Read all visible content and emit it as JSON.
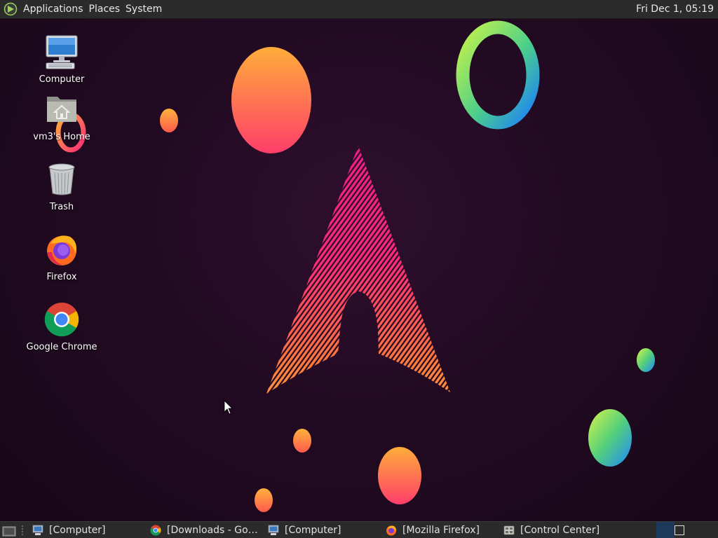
{
  "top_panel": {
    "menus": [
      "Applications",
      "Places",
      "System"
    ],
    "clock": "Fri Dec 1, 05:19"
  },
  "desktop": {
    "icons": [
      {
        "label": "Computer",
        "icon": "computer-icon"
      },
      {
        "label": "vm3's Home",
        "icon": "home-folder-icon"
      },
      {
        "label": "Trash",
        "icon": "trash-icon"
      },
      {
        "label": "Firefox",
        "icon": "firefox-icon"
      },
      {
        "label": "Google Chrome",
        "icon": "chrome-icon"
      }
    ]
  },
  "taskbar": {
    "tasks": [
      {
        "label": "[Computer]",
        "icon": "computer-icon"
      },
      {
        "label": "[Downloads - Goog...",
        "icon": "chrome-icon"
      },
      {
        "label": "[Computer]",
        "icon": "computer-icon"
      },
      {
        "label": "[Mozilla Firefox]",
        "icon": "firefox-icon"
      },
      {
        "label": "[Control Center]",
        "icon": "control-center-icon"
      }
    ]
  },
  "colors": {
    "panel_bg": "#2b2b2b",
    "wallpaper_bg": "#220a22",
    "accent_pink": "#ff2a78",
    "accent_orange": "#ffa53a",
    "accent_green": "#b8f04a",
    "accent_blue": "#2a8cff"
  }
}
